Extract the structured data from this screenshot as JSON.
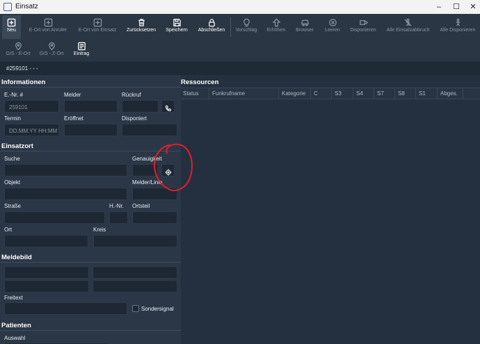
{
  "window": {
    "title": "Einsatz",
    "controls": [
      "–",
      "☐",
      "✕"
    ]
  },
  "toolbar": {
    "buttons": [
      {
        "label": "Neu",
        "icon": "plus-square-icon",
        "enabled": true
      },
      {
        "label": "E-Ort von Anrufer",
        "icon": "plus-square-icon",
        "enabled": false
      },
      {
        "label": "E-Ort von Einsatz",
        "icon": "plus-square-icon",
        "enabled": false
      },
      {
        "label": "Zurücksetzen",
        "icon": "trash-icon",
        "enabled": true
      },
      {
        "label": "Speichern",
        "icon": "save-icon",
        "enabled": true
      },
      {
        "label": "Abschließen",
        "icon": "lock-icon",
        "enabled": true
      },
      {
        "label": "Vorschlag",
        "icon": "lightbulb-icon",
        "enabled": false
      },
      {
        "label": "Erhöhen",
        "icon": "arrow-up-icon",
        "enabled": false
      },
      {
        "label": "Browser",
        "icon": "car-icon",
        "enabled": false
      },
      {
        "label": "Leeren",
        "icon": "clear-circle-icon",
        "enabled": false
      },
      {
        "label": "Disponieren",
        "icon": "dispatch-icon",
        "enabled": false
      },
      {
        "label": "Alle Einsatzabbruch",
        "icon": "cancel-person-icon",
        "enabled": false
      },
      {
        "label": "Alle Disponieren",
        "icon": "dispatch-person-icon",
        "enabled": false
      },
      {
        "label": "GIS - E-Ort",
        "icon": "map-pin-icon",
        "enabled": false
      },
      {
        "label": "GIS - Z-Ort",
        "icon": "map-pin-icon",
        "enabled": false
      },
      {
        "label": "Eintrag",
        "icon": "entry-list-icon",
        "enabled": true
      }
    ]
  },
  "path": "#259101 - - -",
  "informationen": {
    "title": "Informationen",
    "enr_label": "E.-Nr. #",
    "enr_value": "259101",
    "melder_label": "Melder",
    "rueckruf_label": "Rückruf",
    "termin_label": "Termin",
    "termin_placeholder": "DD.MM.YY HH:MM",
    "eroeffnet_label": "Eröffnet",
    "disponiert_label": "Disponiert"
  },
  "einsatzort": {
    "title": "Einsatzort",
    "suche_label": "Suche",
    "genauigkeit_label": "Genauigkeit",
    "objekt_label": "Objekt",
    "melder_linie_label": "Melder/Linie",
    "strasse_label": "Straße",
    "hnr_label": "H.-Nr.",
    "ortsteil_label": "Ortsteil",
    "ort_label": "Ort",
    "kreis_label": "Kreis"
  },
  "meldebild": {
    "title": "Meldebild",
    "freitext_label": "Freitext",
    "sondersignal_label": "Sondersignal",
    "sondersignal_checked": false
  },
  "patienten": {
    "title": "Patienten",
    "auswahl_label": "Auswahl"
  },
  "ressourcen": {
    "title": "Ressourcen",
    "columns": [
      "Status",
      "Funkrufname",
      "Kategorie",
      "C",
      "S3",
      "S4",
      "S7",
      "S8",
      "S1",
      "Abges."
    ]
  },
  "colors": {
    "background": "#24303f",
    "panel": "#2b3747",
    "field": "#1e2835",
    "annotation": "#e0202a"
  }
}
